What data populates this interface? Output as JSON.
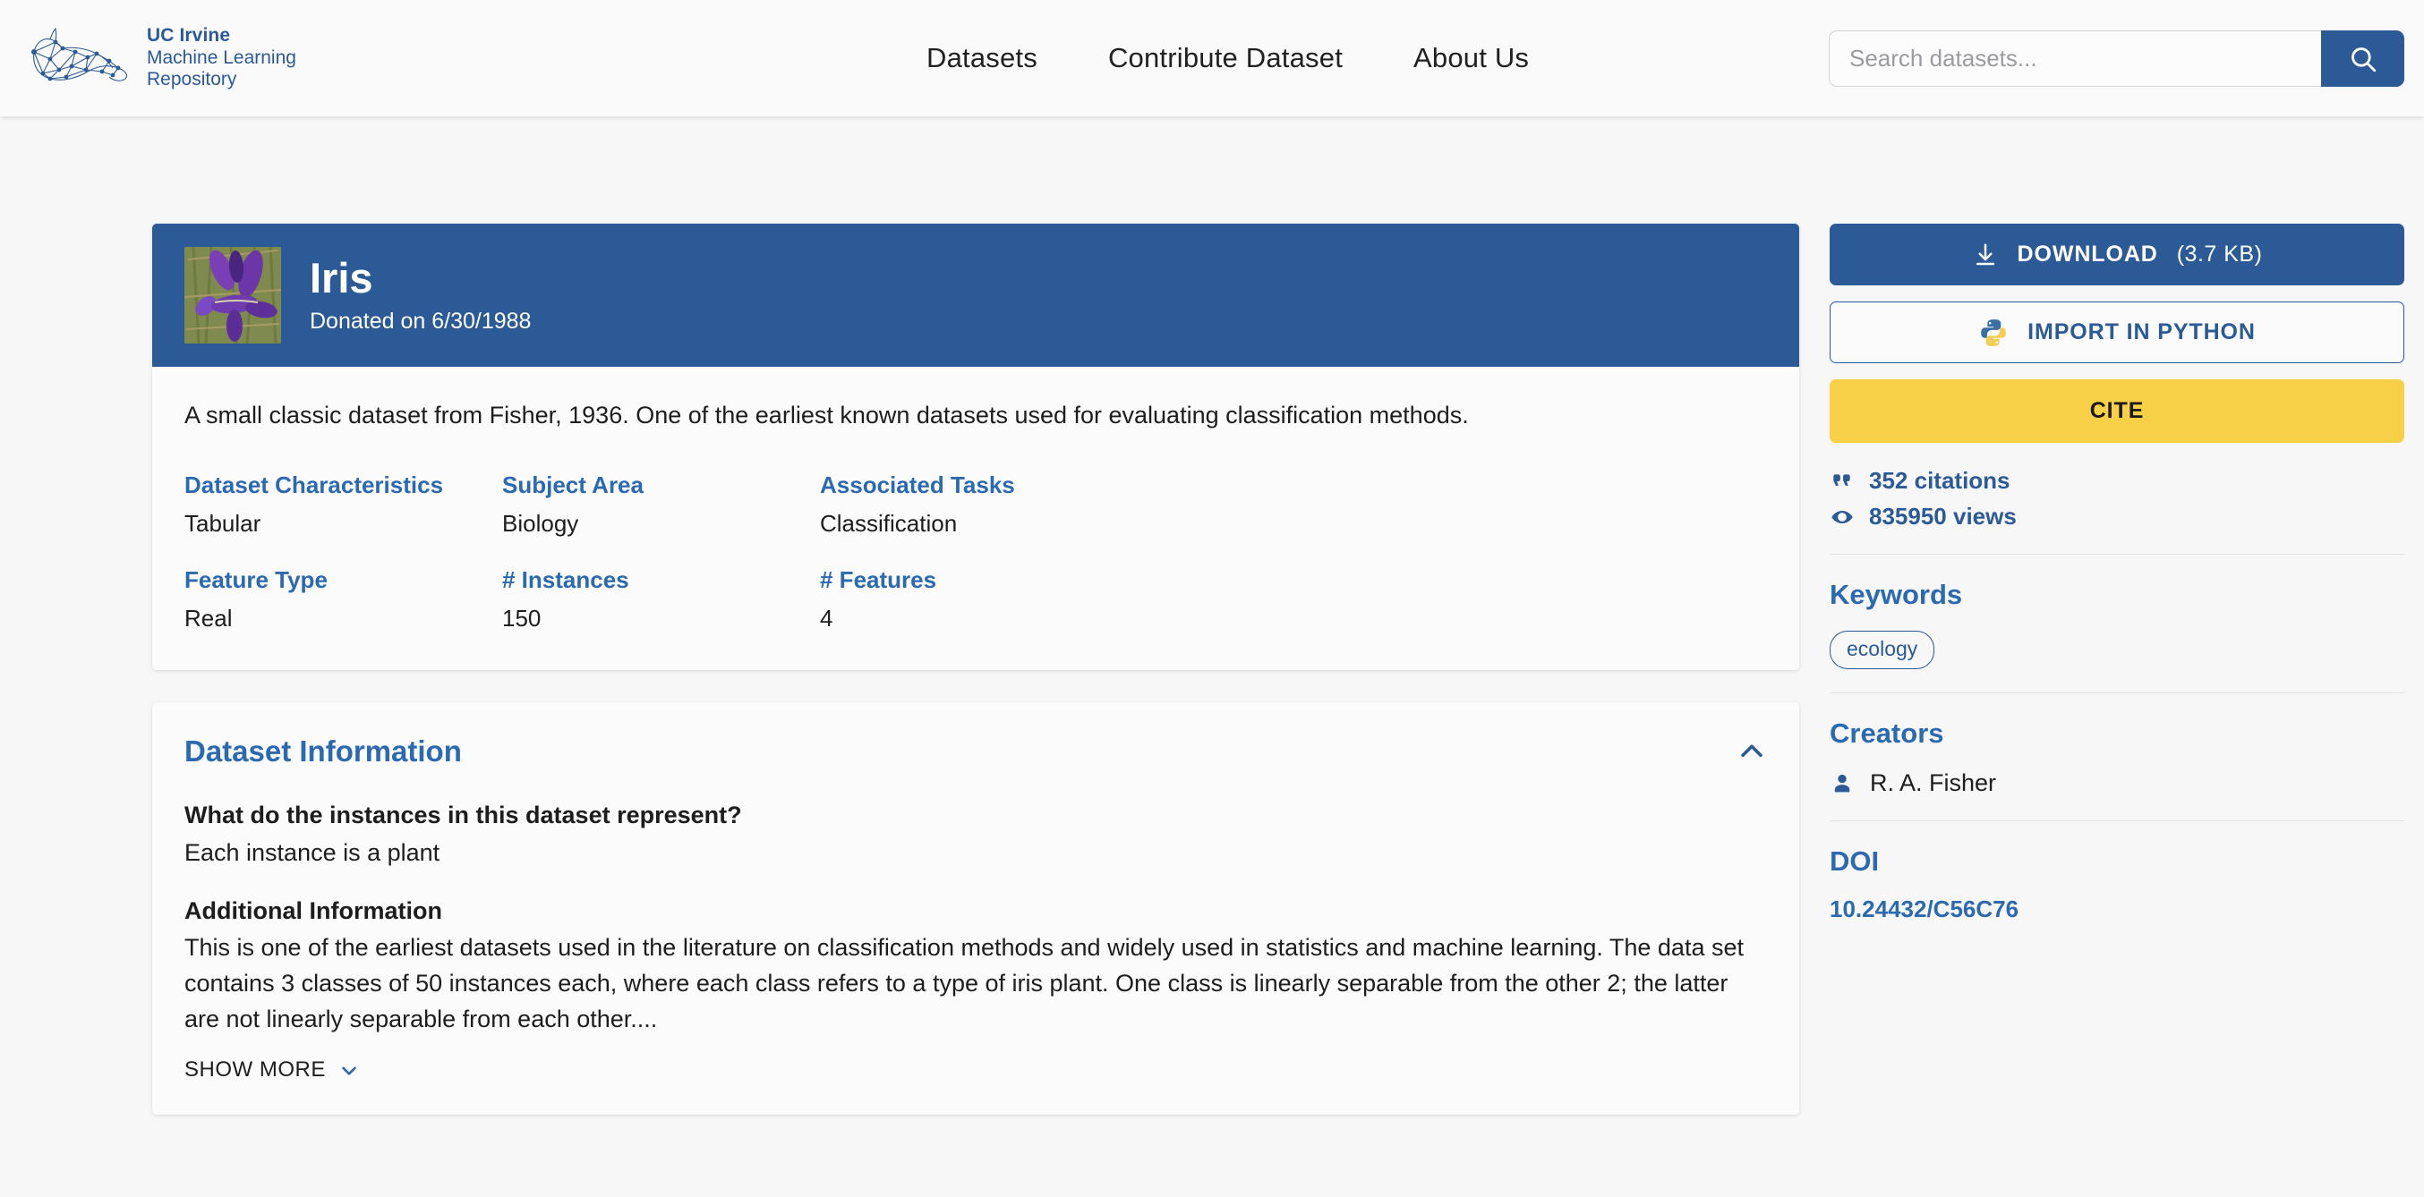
{
  "header": {
    "logo": {
      "line1": "UC Irvine",
      "line2": "Machine Learning",
      "line3": "Repository"
    },
    "nav": [
      {
        "label": "Datasets"
      },
      {
        "label": "Contribute Dataset"
      },
      {
        "label": "About Us"
      }
    ],
    "search": {
      "placeholder": "Search datasets...",
      "value": ""
    }
  },
  "dataset": {
    "title": "Iris",
    "donated": "Donated on 6/30/1988",
    "description": "A small classic dataset from Fisher, 1936. One of the earliest known datasets used for evaluating classification methods.",
    "meta": [
      {
        "label": "Dataset Characteristics",
        "value": "Tabular"
      },
      {
        "label": "Subject Area",
        "value": "Biology"
      },
      {
        "label": "Associated Tasks",
        "value": "Classification"
      },
      {
        "label": "Feature Type",
        "value": "Real"
      },
      {
        "label": "# Instances",
        "value": "150"
      },
      {
        "label": "# Features",
        "value": "4"
      }
    ]
  },
  "info": {
    "title": "Dataset Information",
    "question": "What do the instances in this dataset represent?",
    "answer": "Each instance is a plant",
    "additional_heading": "Additional Information",
    "additional_text": "This is one of the earliest datasets used in the literature on classification methods and widely used in statistics and machine learning.  The data set contains 3 classes of 50 instances each, where each class refers to a type of iris plant.  One class is linearly separable from the other 2; the latter are not linearly separable from each other....",
    "show_more": "SHOW MORE"
  },
  "sidebar": {
    "download_label": "DOWNLOAD",
    "download_size": "(3.7 KB)",
    "python_label": "IMPORT IN PYTHON",
    "cite_label": "CITE",
    "citations": "352 citations",
    "views": "835950 views",
    "keywords_heading": "Keywords",
    "keywords": [
      "ecology"
    ],
    "creators_heading": "Creators",
    "creators": [
      "R. A. Fisher"
    ],
    "doi_heading": "DOI",
    "doi_value": "10.24432/C56C76"
  },
  "colors": {
    "brand_blue": "#2b5a96",
    "link_blue": "#2b69b0",
    "cite_yellow": "#f7d048",
    "page_bg": "#f7f7f8"
  }
}
